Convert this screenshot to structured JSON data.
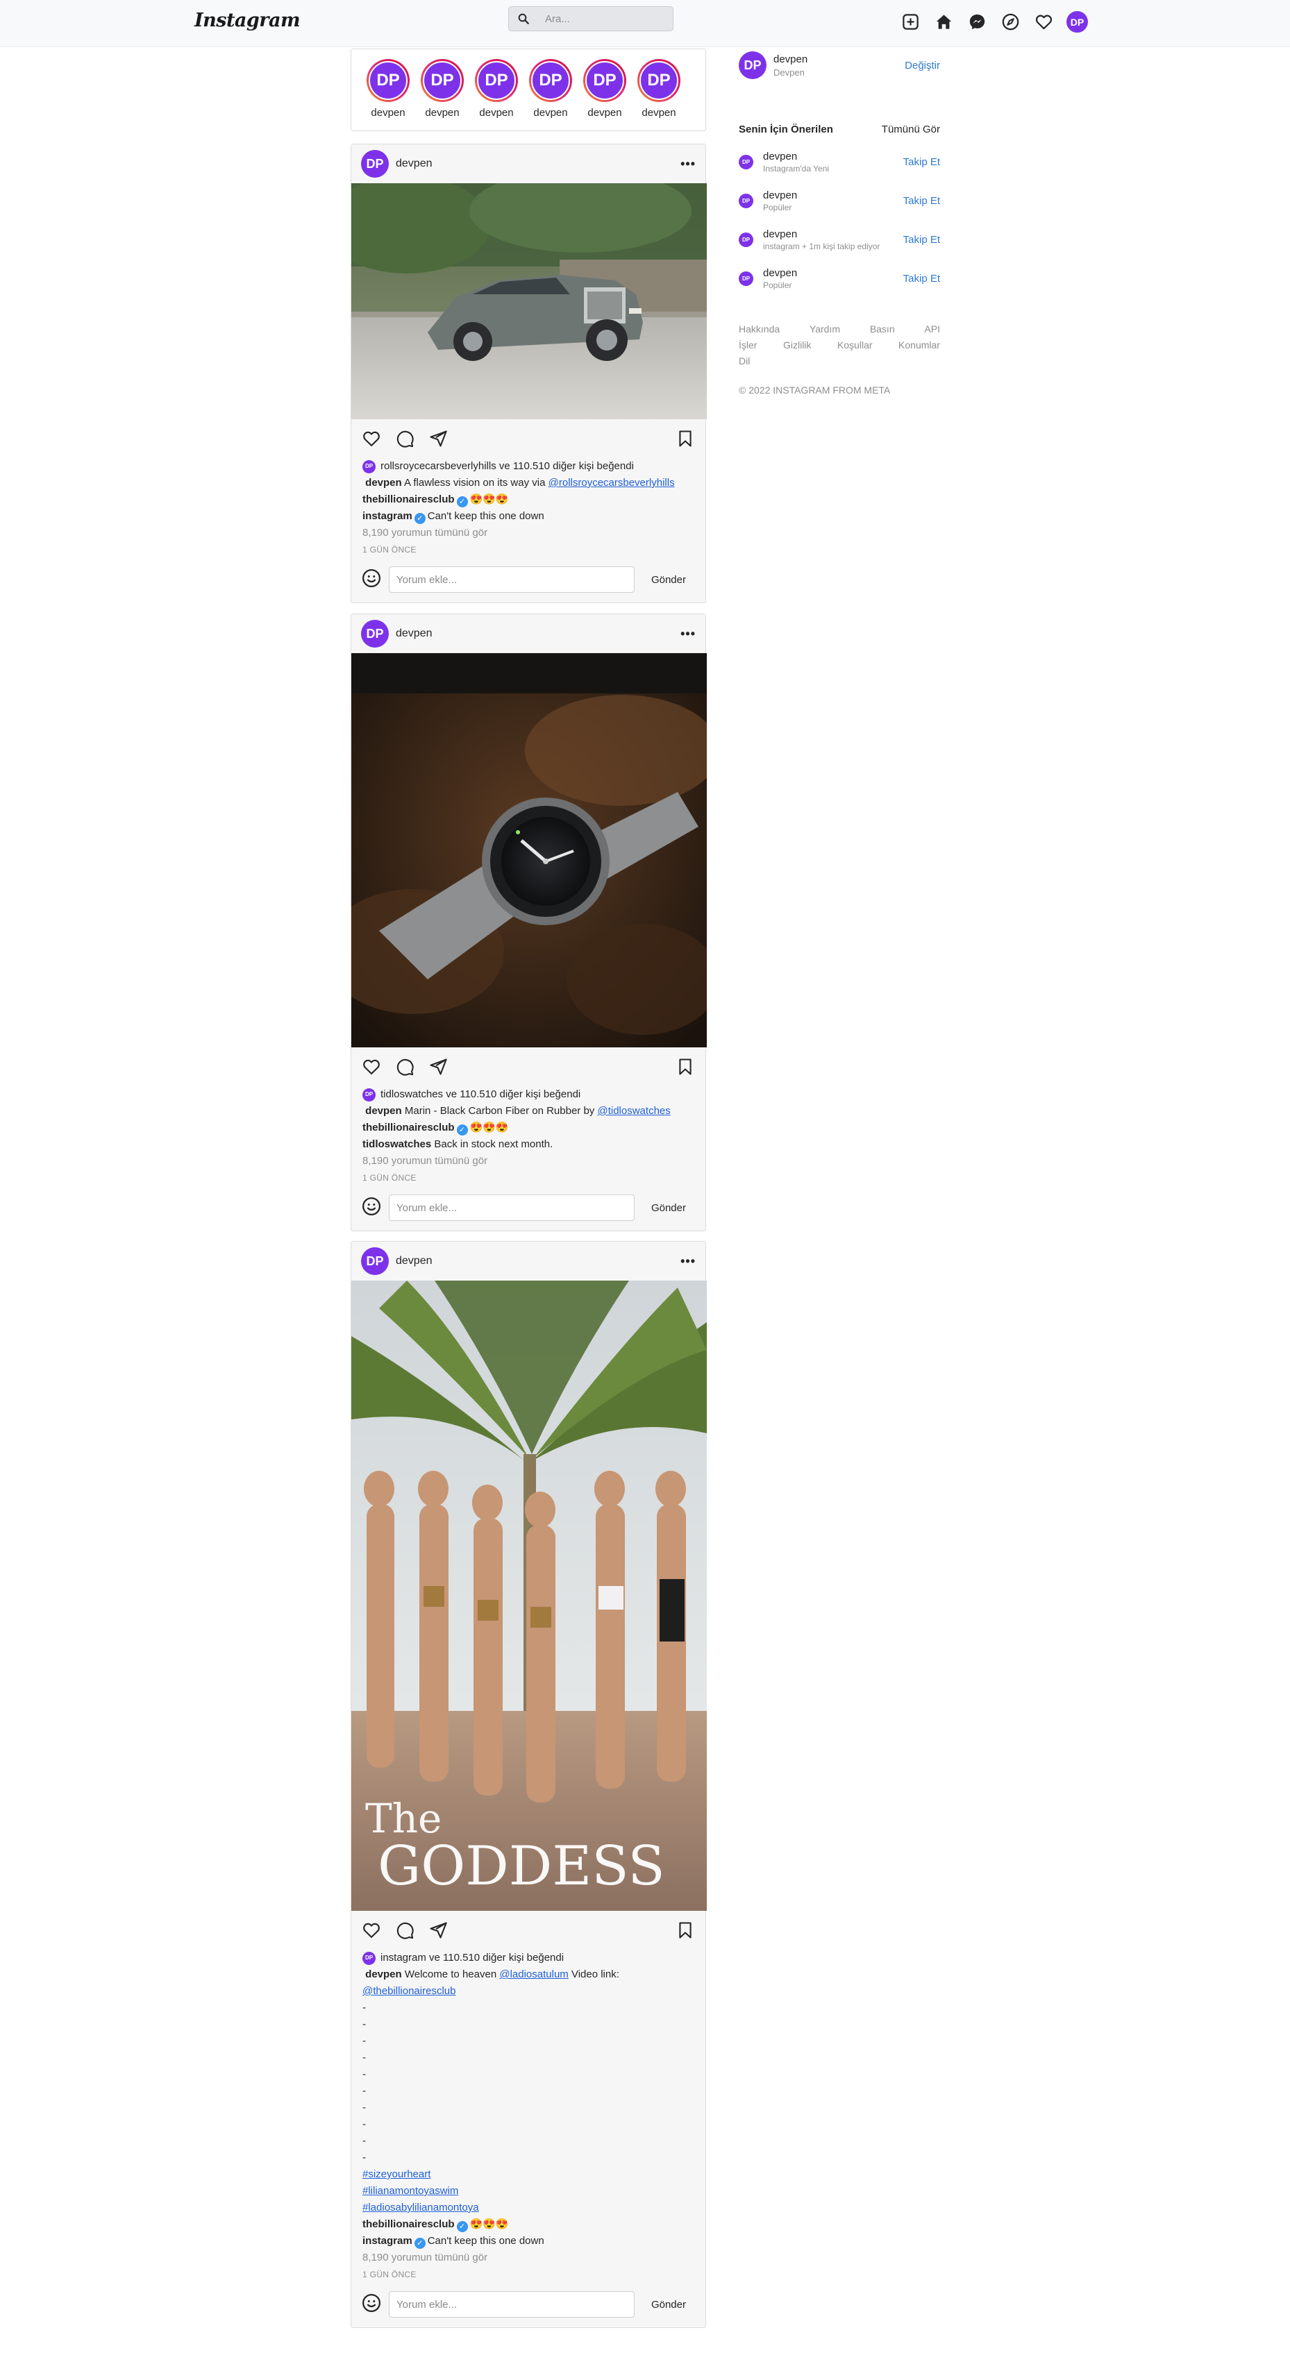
{
  "app": {
    "logo": "Instagram"
  },
  "search": {
    "placeholder": "Ara..."
  },
  "nav": {
    "avatar_initials": "DP"
  },
  "stories": [
    {
      "initials": "DP",
      "name": "devpen"
    },
    {
      "initials": "DP",
      "name": "devpen"
    },
    {
      "initials": "DP",
      "name": "devpen"
    },
    {
      "initials": "DP",
      "name": "devpen"
    },
    {
      "initials": "DP",
      "name": "devpen"
    },
    {
      "initials": "DP",
      "name": "devpen"
    }
  ],
  "posts": [
    {
      "avatar": "DP",
      "user": "devpen",
      "more": "•••",
      "liked_by": "rollsroycecarsbeverlyhills ve 110.510 diğer kişi beğendi",
      "caption_user": "devpen",
      "caption_text": "A flawless vision on its way via",
      "caption_link": "@rollsroycecarsbeverlyhills",
      "comments": [
        {
          "user": "thebillionairesclub",
          "text": "😍😍😍",
          "verified": true
        },
        {
          "user": "instagram",
          "text": "Can't keep this one down",
          "verified": true
        }
      ],
      "view_all": "8,190 yorumun tümünü gör",
      "time": "1 GÜN ÖNCE",
      "comment_placeholder": "Yorum ekle...",
      "send": "Gönder"
    },
    {
      "avatar": "DP",
      "user": "devpen",
      "more": "•••",
      "liked_by": "tidloswatches ve 110.510 diğer kişi beğendi",
      "caption_user": "devpen",
      "caption_text": "Marin - Black Carbon Fiber on Rubber by",
      "caption_link": "@tidloswatches",
      "comments": [
        {
          "user": "thebillionairesclub",
          "text": "😍😍😍",
          "verified": true
        },
        {
          "user": "tidloswatches",
          "text": "Back in stock next month.",
          "verified": false
        }
      ],
      "view_all": "8,190 yorumun tümünü gör",
      "time": "1 GÜN ÖNCE",
      "comment_placeholder": "Yorum ekle...",
      "send": "Gönder"
    },
    {
      "avatar": "DP",
      "user": "devpen",
      "more": "•••",
      "image_title_top": "The",
      "image_title_main": "GODDESS",
      "liked_by": "instagram ve 110.510 diğer kişi beğendi",
      "caption_user": "devpen",
      "caption_text": "Welcome to heaven",
      "caption_link": "@ladiosatulum",
      "caption_text2": "Video link:",
      "caption_link2": "@thebillionairesclub",
      "dashes": [
        "-",
        "-",
        "-",
        "-",
        "-",
        "-",
        "-",
        "-",
        "-",
        "-"
      ],
      "hashtags": [
        "#sizeyourheart",
        "#lilianamontoyaswim",
        "#ladiosabylilianamontoya"
      ],
      "comments": [
        {
          "user": "thebillionairesclub",
          "text": "😍😍😍",
          "verified": true
        },
        {
          "user": "instagram",
          "text": "Can't keep this one down",
          "verified": true
        }
      ],
      "view_all": "8,190 yorumun tümünü gör",
      "time": "1 GÜN ÖNCE",
      "comment_placeholder": "Yorum ekle...",
      "send": "Gönder"
    }
  ],
  "sidebar": {
    "me": {
      "initials": "DP",
      "user": "devpen",
      "name": "Devpen",
      "switch": "Değiştir"
    },
    "suggestions_title": "Senin İçin Önerilen",
    "see_all": "Tümünü Gör",
    "suggestions": [
      {
        "initials": "DP",
        "user": "devpen",
        "sub": "Instagram'da Yeni",
        "action": "Takip Et"
      },
      {
        "initials": "DP",
        "user": "devpen",
        "sub": "Popüler",
        "action": "Takip Et"
      },
      {
        "initials": "DP",
        "user": "devpen",
        "sub": "instagram + 1m kişi takip ediyor",
        "action": "Takip Et"
      },
      {
        "initials": "DP",
        "user": "devpen",
        "sub": "Popüler",
        "action": "Takip Et"
      }
    ],
    "footer_row1": [
      "Hakkında",
      "Yardım",
      "Basın",
      "API"
    ],
    "footer_row2": [
      "İşler",
      "Gizlilik",
      "Koşullar",
      "Konumlar"
    ],
    "footer_row3": [
      "Dil"
    ],
    "copyright": "© 2022 INSTAGRAM FROM META"
  }
}
